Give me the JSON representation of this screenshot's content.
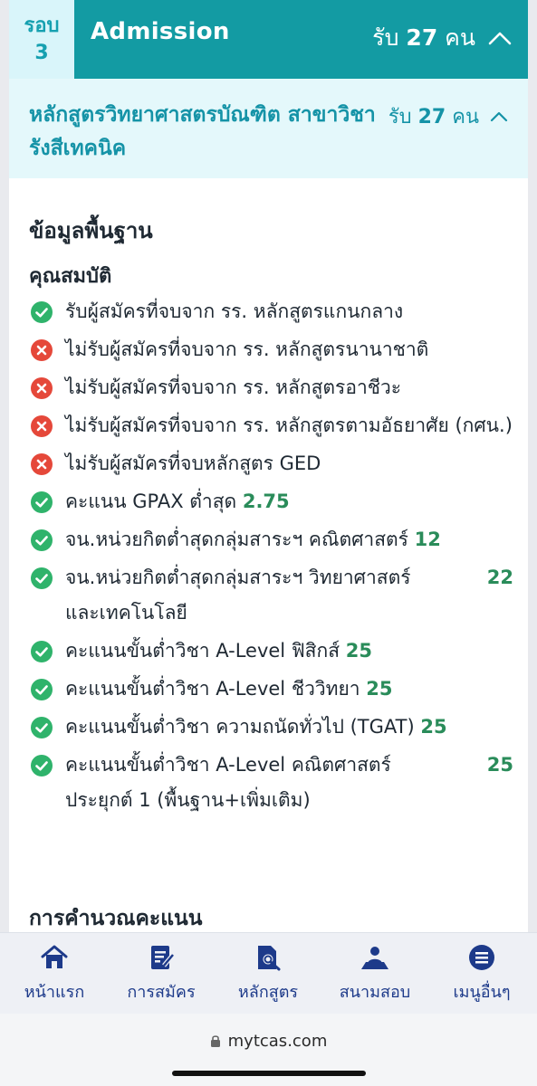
{
  "round": {
    "label_line1": "รอบ",
    "label_line2": "3",
    "title": "Admission",
    "accept_label": "รับ",
    "accept_count": "27",
    "accept_unit": "คน"
  },
  "program": {
    "title": "หลักสูตรวิทยาศาสตรบัณฑิต สาขาวิชารังสีเทคนิค",
    "accept_label": "รับ",
    "accept_count": "27",
    "accept_unit": "คน"
  },
  "content": {
    "basic_heading": "ข้อมูลพื้นฐาน",
    "qualification_heading": "คุณสมบัติ",
    "calc_heading": "การคำนวณคะแนน",
    "qualifications": [
      {
        "status": "yes",
        "text": "รับผู้สมัครที่จบจาก รร. หลักสูตรแกนกลาง",
        "value": ""
      },
      {
        "status": "no",
        "text": "ไม่รับผู้สมัครที่จบจาก รร. หลักสูตรนานาชาติ",
        "value": ""
      },
      {
        "status": "no",
        "text": "ไม่รับผู้สมัครที่จบจาก รร. หลักสูตรอาชีวะ",
        "value": ""
      },
      {
        "status": "no",
        "text": "ไม่รับผู้สมัครที่จบจาก รร. หลักสูตรตามอัธยาศัย (กศน.)",
        "value": ""
      },
      {
        "status": "no",
        "text": "ไม่รับผู้สมัครที่จบหลักสูตร GED",
        "value": ""
      },
      {
        "status": "yes",
        "text": "คะแนน GPAX ต่ำสุด",
        "value": "2.75"
      },
      {
        "status": "yes",
        "text": "จน.หน่วยกิตต่ำสุดกลุ่มสาระฯ คณิตศาสตร์",
        "value": "12"
      },
      {
        "status": "yes",
        "text": "จน.หน่วยกิตต่ำสุดกลุ่มสาระฯ วิทยาศาสตร์ และเทคโนโลยี",
        "value": "22"
      },
      {
        "status": "yes",
        "text": "คะแนนขั้นต่ำวิชา A-Level ฟิสิกส์",
        "value": "25"
      },
      {
        "status": "yes",
        "text": "คะแนนขั้นต่ำวิชา A-Level ชีววิทยา",
        "value": "25"
      },
      {
        "status": "yes",
        "text": "คะแนนขั้นต่ำวิชา ความถนัดทั่วไป (TGAT)",
        "value": "25"
      },
      {
        "status": "yes",
        "text": "คะแนนขั้นต่ำวิชา A-Level คณิตศาสตร์ประยุกต์ 1 (พื้นฐาน+เพิ่มเติม)",
        "value": "25"
      }
    ]
  },
  "nav": {
    "items": [
      {
        "label": "หน้าแรก",
        "icon": "home-icon"
      },
      {
        "label": "การสมัคร",
        "icon": "application-form-icon"
      },
      {
        "label": "หลักสูตร",
        "icon": "course-search-icon"
      },
      {
        "label": "สนามสอบ",
        "icon": "exam-site-icon"
      },
      {
        "label": "เมนูอื่นๆ",
        "icon": "menu-icon"
      }
    ]
  },
  "browser": {
    "url": "mytcas.com"
  },
  "colors": {
    "header_teal": "#139ba3",
    "round_box_bg": "#d9f5fa",
    "program_bg": "#e4f8fb",
    "check_green": "#2fb36b",
    "cross_red": "#e5483a",
    "value_green": "#2a8c5a",
    "nav_blue": "#1d3a8a"
  }
}
